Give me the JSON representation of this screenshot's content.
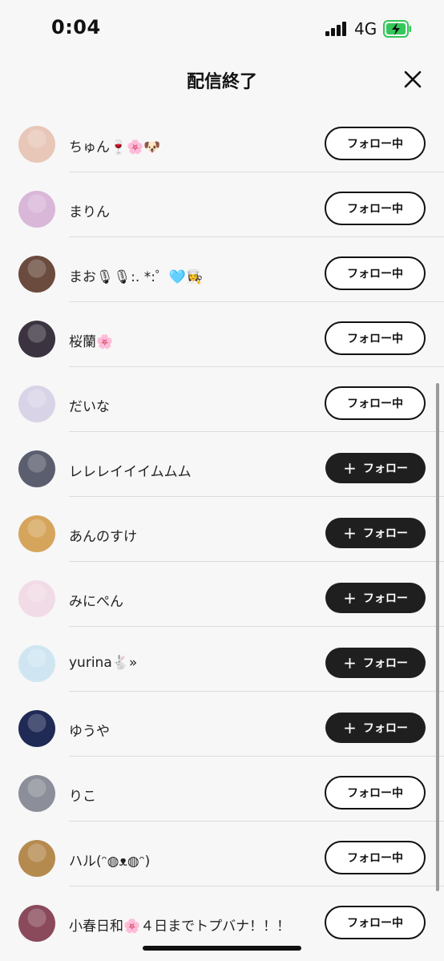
{
  "status_bar": {
    "time": "0:04",
    "network": "4G",
    "battery_color": "#34c759"
  },
  "header": {
    "title": "配信終了",
    "close_icon": "close-icon"
  },
  "users": [
    {
      "name": "ちゅん🍷🌸🐶",
      "button": "フォロー中",
      "state": "following",
      "avatar_color": "#e8c7b8"
    },
    {
      "name": "まりん",
      "button": "フォロー中",
      "state": "following",
      "avatar_color": "#d9b7d8"
    },
    {
      "name": "まお🎙🎙:. *:゜🩵👩‍🍳",
      "button": "フォロー中",
      "state": "following",
      "avatar_color": "#6a4b3e"
    },
    {
      "name": "桜蘭🌸",
      "button": "フォロー中",
      "state": "following",
      "avatar_color": "#3b3440"
    },
    {
      "name": "だいな",
      "button": "フォロー中",
      "state": "following",
      "avatar_color": "#d8d3e6"
    },
    {
      "name": "レレレイイイムムム",
      "button": "フォロー",
      "state": "follow",
      "avatar_color": "#5b5e6e"
    },
    {
      "name": "あんのすけ",
      "button": "フォロー",
      "state": "follow",
      "avatar_color": "#d6a55c"
    },
    {
      "name": "みにぺん",
      "button": "フォロー",
      "state": "follow",
      "avatar_color": "#f1dbe6"
    },
    {
      "name": "yurina🐇»",
      "button": "フォロー",
      "state": "follow",
      "avatar_color": "#cfe6f2"
    },
    {
      "name": "ゆうや",
      "button": "フォロー",
      "state": "follow",
      "avatar_color": "#1f2a55"
    },
    {
      "name": "りこ",
      "button": "フォロー中",
      "state": "following",
      "avatar_color": "#8c8f99"
    },
    {
      "name": "ハル(ᵔ◍ᴥ◍ᵔ)",
      "button": "フォロー中",
      "state": "following",
      "avatar_color": "#b58a4f"
    },
    {
      "name": "小春日和🌸４日までトプバナ！！！",
      "button": "フォロー中",
      "state": "following",
      "avatar_color": "#8a4a5c"
    }
  ]
}
